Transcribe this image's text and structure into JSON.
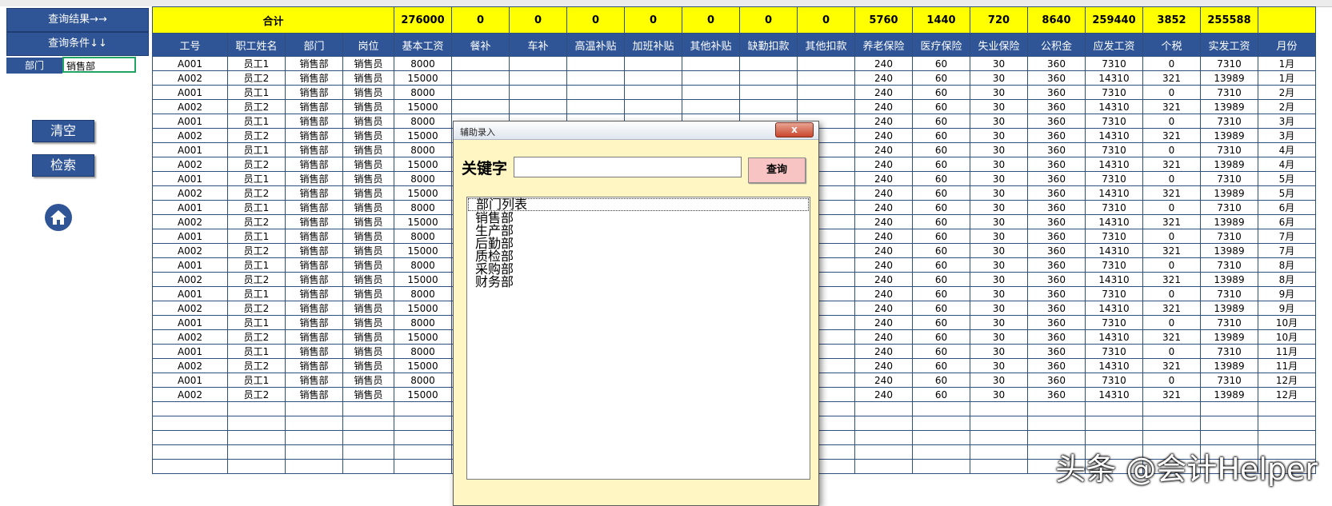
{
  "sidebar": {
    "results_btn": "查询结果→→",
    "conditions_btn": "查询条件↓↓",
    "condition_label": "部门",
    "condition_value": "销售部",
    "clear_btn": "清空",
    "search_btn": "检索"
  },
  "sheet": {
    "total_label": "合计",
    "totals": [
      "276000",
      "0",
      "0",
      "0",
      "0",
      "0",
      "0",
      "0",
      "5760",
      "1440",
      "720",
      "8640",
      "259440",
      "3852",
      "255588",
      ""
    ],
    "headers": [
      "工号",
      "职工姓名",
      "部门",
      "岗位",
      "基本工资",
      "餐补",
      "车补",
      "高温补贴",
      "加班补贴",
      "其他补贴",
      "缺勤扣款",
      "其他扣款",
      "养老保险",
      "医疗保险",
      "失业保险",
      "公积金",
      "应发工资",
      "个税",
      "实发工资",
      "月份"
    ],
    "rows": [
      [
        "A001",
        "员工1",
        "销售部",
        "销售员",
        "8000",
        "",
        "",
        "",
        "",
        "",
        "",
        "",
        "240",
        "60",
        "30",
        "360",
        "7310",
        "0",
        "7310",
        "1月"
      ],
      [
        "A002",
        "员工2",
        "销售部",
        "销售员",
        "15000",
        "",
        "",
        "",
        "",
        "",
        "",
        "",
        "240",
        "60",
        "30",
        "360",
        "14310",
        "321",
        "13989",
        "1月"
      ],
      [
        "A001",
        "员工1",
        "销售部",
        "销售员",
        "8000",
        "",
        "",
        "",
        "",
        "",
        "",
        "",
        "240",
        "60",
        "30",
        "360",
        "7310",
        "0",
        "7310",
        "2月"
      ],
      [
        "A002",
        "员工2",
        "销售部",
        "销售员",
        "15000",
        "",
        "",
        "",
        "",
        "",
        "",
        "",
        "240",
        "60",
        "30",
        "360",
        "14310",
        "321",
        "13989",
        "2月"
      ],
      [
        "A001",
        "员工1",
        "销售部",
        "销售员",
        "8000",
        "",
        "",
        "",
        "",
        "",
        "",
        "",
        "240",
        "60",
        "30",
        "360",
        "7310",
        "0",
        "7310",
        "3月"
      ],
      [
        "A002",
        "员工2",
        "销售部",
        "销售员",
        "15000",
        "",
        "",
        "",
        "",
        "",
        "",
        "",
        "240",
        "60",
        "30",
        "360",
        "14310",
        "321",
        "13989",
        "3月"
      ],
      [
        "A001",
        "员工1",
        "销售部",
        "销售员",
        "8000",
        "",
        "",
        "",
        "",
        "",
        "",
        "",
        "240",
        "60",
        "30",
        "360",
        "7310",
        "0",
        "7310",
        "4月"
      ],
      [
        "A002",
        "员工2",
        "销售部",
        "销售员",
        "15000",
        "",
        "",
        "",
        "",
        "",
        "",
        "",
        "240",
        "60",
        "30",
        "360",
        "14310",
        "321",
        "13989",
        "4月"
      ],
      [
        "A001",
        "员工1",
        "销售部",
        "销售员",
        "8000",
        "",
        "",
        "",
        "",
        "",
        "",
        "",
        "240",
        "60",
        "30",
        "360",
        "7310",
        "0",
        "7310",
        "5月"
      ],
      [
        "A002",
        "员工2",
        "销售部",
        "销售员",
        "15000",
        "",
        "",
        "",
        "",
        "",
        "",
        "",
        "240",
        "60",
        "30",
        "360",
        "14310",
        "321",
        "13989",
        "5月"
      ],
      [
        "A001",
        "员工1",
        "销售部",
        "销售员",
        "8000",
        "",
        "",
        "",
        "",
        "",
        "",
        "",
        "240",
        "60",
        "30",
        "360",
        "7310",
        "0",
        "7310",
        "6月"
      ],
      [
        "A002",
        "员工2",
        "销售部",
        "销售员",
        "15000",
        "",
        "",
        "",
        "",
        "",
        "",
        "",
        "240",
        "60",
        "30",
        "360",
        "14310",
        "321",
        "13989",
        "6月"
      ],
      [
        "A001",
        "员工1",
        "销售部",
        "销售员",
        "8000",
        "",
        "",
        "",
        "",
        "",
        "",
        "",
        "240",
        "60",
        "30",
        "360",
        "7310",
        "0",
        "7310",
        "7月"
      ],
      [
        "A002",
        "员工2",
        "销售部",
        "销售员",
        "15000",
        "",
        "",
        "",
        "",
        "",
        "",
        "",
        "240",
        "60",
        "30",
        "360",
        "14310",
        "321",
        "13989",
        "7月"
      ],
      [
        "A001",
        "员工1",
        "销售部",
        "销售员",
        "8000",
        "",
        "",
        "",
        "",
        "",
        "",
        "",
        "240",
        "60",
        "30",
        "360",
        "7310",
        "0",
        "7310",
        "8月"
      ],
      [
        "A002",
        "员工2",
        "销售部",
        "销售员",
        "15000",
        "",
        "",
        "",
        "",
        "",
        "",
        "",
        "240",
        "60",
        "30",
        "360",
        "14310",
        "321",
        "13989",
        "8月"
      ],
      [
        "A001",
        "员工1",
        "销售部",
        "销售员",
        "8000",
        "",
        "",
        "",
        "",
        "",
        "",
        "",
        "240",
        "60",
        "30",
        "360",
        "7310",
        "0",
        "7310",
        "9月"
      ],
      [
        "A002",
        "员工2",
        "销售部",
        "销售员",
        "15000",
        "",
        "",
        "",
        "",
        "",
        "",
        "",
        "240",
        "60",
        "30",
        "360",
        "14310",
        "321",
        "13989",
        "9月"
      ],
      [
        "A001",
        "员工1",
        "销售部",
        "销售员",
        "8000",
        "",
        "",
        "",
        "",
        "",
        "",
        "",
        "240",
        "60",
        "30",
        "360",
        "7310",
        "0",
        "7310",
        "10月"
      ],
      [
        "A002",
        "员工2",
        "销售部",
        "销售员",
        "15000",
        "",
        "",
        "",
        "",
        "",
        "",
        "",
        "240",
        "60",
        "30",
        "360",
        "14310",
        "321",
        "13989",
        "10月"
      ],
      [
        "A001",
        "员工1",
        "销售部",
        "销售员",
        "8000",
        "",
        "",
        "",
        "",
        "",
        "",
        "",
        "240",
        "60",
        "30",
        "360",
        "7310",
        "0",
        "7310",
        "11月"
      ],
      [
        "A002",
        "员工2",
        "销售部",
        "销售员",
        "15000",
        "",
        "",
        "",
        "",
        "",
        "",
        "",
        "240",
        "60",
        "30",
        "360",
        "14310",
        "321",
        "13989",
        "11月"
      ],
      [
        "A001",
        "员工1",
        "销售部",
        "销售员",
        "8000",
        "",
        "",
        "",
        "",
        "",
        "",
        "",
        "240",
        "60",
        "30",
        "360",
        "7310",
        "0",
        "7310",
        "12月"
      ],
      [
        "A002",
        "员工2",
        "销售部",
        "销售员",
        "15000",
        "",
        "",
        "",
        "",
        "",
        "",
        "",
        "240",
        "60",
        "30",
        "360",
        "14310",
        "321",
        "13989",
        "12月"
      ]
    ],
    "empty_rows": 5
  },
  "dialog": {
    "title": "辅助录入",
    "close_glyph": "x",
    "keyword_label": "关键字",
    "keyword_value": "",
    "query_btn": "查询",
    "list_items": [
      "部门列表",
      "销售部",
      "生产部",
      "后勤部",
      "质检部",
      "采购部",
      "财务部"
    ]
  },
  "watermark": "头条 @会计Helper",
  "icons": {
    "home": "home-icon"
  },
  "colors": {
    "accent": "#2f5597",
    "total_bg": "#ffff00",
    "dialog_bg": "#fff6c4",
    "query_btn": "#f7c3c3"
  }
}
